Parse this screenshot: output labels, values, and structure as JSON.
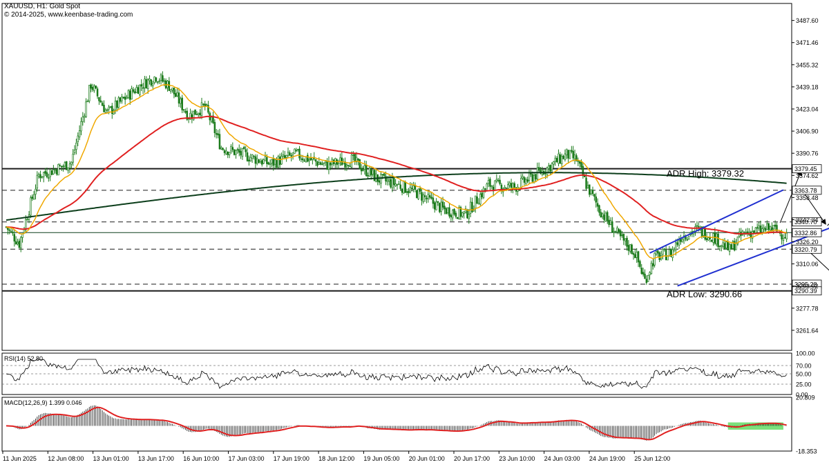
{
  "header": {
    "title": "XAUUSD, H1:  Gold Spot",
    "copyright": "© 2014-2025, www.keenbase-trading.com"
  },
  "chart_data": [
    {
      "type": "candlestick",
      "ylim": [
        3247.0,
        3500.0
      ],
      "y_ticks": [
        "3487.60",
        "3471.46",
        "3455.32",
        "3439.18",
        "3423.04",
        "3406.90",
        "3390.76",
        "3374.62",
        "3358.48",
        "3342.34",
        "3326.20",
        "3310.06",
        "3293.92",
        "3277.78",
        "3261.64"
      ],
      "x_ticks": [
        "11 Jun 2025",
        "12 Jun 08:00",
        "13 Jun 01:00",
        "13 Jun 17:00",
        "16 Jun 10:00",
        "17 Jun 03:00",
        "17 Jun 19:00",
        "18 Jun 12:00",
        "19 Jun 05:00",
        "20 Jun 01:00",
        "20 Jun 17:00",
        "23 Jun 10:00",
        "24 Jun 03:00",
        "24 Jun 19:00",
        "25 Jun 12:00"
      ],
      "waypoints": [
        [
          0,
          3337
        ],
        [
          8,
          3325
        ],
        [
          20,
          3375
        ],
        [
          28,
          3378
        ],
        [
          40,
          3384
        ],
        [
          52,
          3441
        ],
        [
          62,
          3420
        ],
        [
          80,
          3438
        ],
        [
          92,
          3447
        ],
        [
          100,
          3440
        ],
        [
          112,
          3418
        ],
        [
          122,
          3425
        ],
        [
          132,
          3395
        ],
        [
          150,
          3388
        ],
        [
          162,
          3383
        ],
        [
          178,
          3390
        ],
        [
          196,
          3382
        ],
        [
          212,
          3386
        ],
        [
          228,
          3372
        ],
        [
          240,
          3368
        ],
        [
          252,
          3362
        ],
        [
          268,
          3350
        ],
        [
          282,
          3346
        ],
        [
          296,
          3368
        ],
        [
          312,
          3366
        ],
        [
          332,
          3380
        ],
        [
          344,
          3390
        ],
        [
          350,
          3386
        ],
        [
          356,
          3368
        ],
        [
          364,
          3350
        ],
        [
          376,
          3330
        ],
        [
          386,
          3318
        ],
        [
          392,
          3298
        ],
        [
          398,
          3315
        ],
        [
          408,
          3318
        ],
        [
          414,
          3330
        ],
        [
          424,
          3335
        ],
        [
          434,
          3330
        ],
        [
          444,
          3320
        ],
        [
          452,
          3332
        ],
        [
          460,
          3334
        ],
        [
          470,
          3336
        ],
        [
          478,
          3331
        ]
      ],
      "ema_fast_lag": 6,
      "ema_slow_lag": 30,
      "ma_long": {
        "start": 3342,
        "mid": 3372,
        "end": 3365
      },
      "levels": [
        {
          "value": 3379.45,
          "label": "3379.45",
          "style": "solid-dark"
        },
        {
          "value": 3363.78,
          "label": "3363.78",
          "style": "dashed"
        },
        {
          "value": 3340.7,
          "label": "3340.70",
          "style": "dashed"
        },
        {
          "value": 3332.86,
          "label": "3332.86",
          "style": "solid-green"
        },
        {
          "value": 3320.79,
          "label": "3320.79",
          "style": "dashed"
        },
        {
          "value": 3295.28,
          "label": "3295.28",
          "style": "dashed"
        },
        {
          "value": 3290.39,
          "label": "3290.39",
          "style": "solid-dark"
        }
      ],
      "annotations": {
        "adr_high": "ADR High: 3379.32",
        "adr_low": "ADR Low: 3290.66"
      },
      "channel": {
        "upper": [
          [
            395,
            3318
          ],
          [
            477,
            3364
          ]
        ],
        "lower": [
          [
            412,
            3294
          ],
          [
            525,
            3345
          ]
        ]
      },
      "arrows": [
        [
          [
            475,
            3340
          ],
          [
            488,
            3378
          ]
        ],
        [
          [
            489,
            3363
          ],
          [
            503,
            3339
          ]
        ],
        [
          [
            504,
            3338
          ],
          [
            527,
            3364
          ]
        ],
        [
          [
            492,
            3320
          ],
          [
            518,
            3291
          ]
        ]
      ],
      "colors": {
        "candle": "#1a7a1a",
        "ema_fast": "#f0a800",
        "ema_slow": "#e02020",
        "ma_long": "#0b3d1a",
        "channel": "#1f2fd0",
        "arrow": "#000000"
      }
    },
    {
      "type": "line",
      "title": "RSI(14) 52.80",
      "ylim": [
        0,
        100
      ],
      "y_ticks": [
        "100.00",
        "70.00",
        "50.00",
        "25.00",
        "0.00"
      ],
      "levels": [
        70,
        50,
        25
      ],
      "amplitude": 12
    },
    {
      "type": "histogram+line",
      "title": "MACD(12,26,9) 1.399 0.046",
      "ylim": [
        -18.353,
        20.809
      ],
      "y_ticks": [
        "20.809",
        "-18.353"
      ],
      "highlight_range": [
        443,
        477
      ],
      "colors": {
        "signal": "#e02020",
        "highlight": "#7be07b"
      }
    }
  ]
}
